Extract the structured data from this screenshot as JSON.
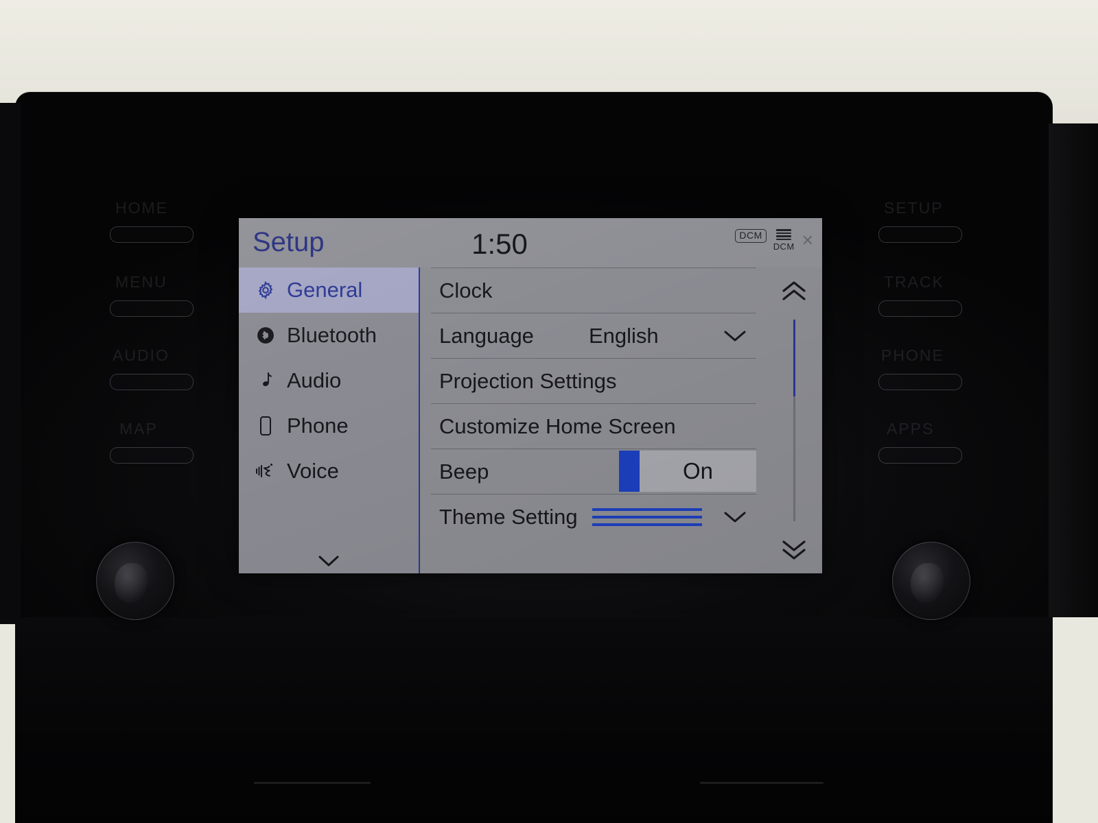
{
  "screen": {
    "header": {
      "title": "Setup",
      "clock": "1:50",
      "status": {
        "dcm_badge": "DCM",
        "signal_label": "DCM",
        "signal_icon": "signal-bars-icon",
        "badge_icon": "dcm-badge-icon"
      }
    },
    "sidebar": {
      "items": [
        {
          "label": "General",
          "icon": "gear-icon",
          "selected": true
        },
        {
          "label": "Bluetooth",
          "icon": "bluetooth-icon",
          "selected": false
        },
        {
          "label": "Audio",
          "icon": "music-note-icon",
          "selected": false
        },
        {
          "label": "Phone",
          "icon": "phone-icon",
          "selected": false
        },
        {
          "label": "Voice",
          "icon": "voice-icon",
          "selected": false
        }
      ],
      "more_icon": "chevron-down-icon"
    },
    "list": {
      "rows": [
        {
          "label": "Clock",
          "value": "",
          "control": "none"
        },
        {
          "label": "Language",
          "value": "English",
          "control": "dropdown"
        },
        {
          "label": "Projection Settings",
          "value": "",
          "control": "none"
        },
        {
          "label": "Customize Home Screen",
          "value": "",
          "control": "none"
        },
        {
          "label": "Beep",
          "value": "On",
          "control": "toggle"
        },
        {
          "label": "Theme Setting",
          "value": "",
          "control": "theme"
        }
      ]
    },
    "scrollbar": {
      "up_icon": "double-chevron-up-icon",
      "down_icon": "double-chevron-down-icon",
      "thumb_position_percent": 0,
      "thumb_size_percent": 38
    },
    "colors": {
      "accent_blue": "#2b3793",
      "toggle_blue": "#1c3fbd",
      "screen_bg": "#8b8b92",
      "selected_bg": "#a3a5c3",
      "text_dark": "#16161b"
    }
  },
  "hardware": {
    "left_buttons": [
      {
        "label": "HOME"
      },
      {
        "label": "MENU"
      },
      {
        "label": "AUDIO"
      },
      {
        "label": "MAP"
      }
    ],
    "right_buttons": [
      {
        "label": "SETUP"
      },
      {
        "label": "TRACK"
      },
      {
        "label": "PHONE"
      },
      {
        "label": "APPS"
      }
    ],
    "knobs": [
      {
        "name": "power-volume-knob"
      },
      {
        "name": "tune-scroll-knob"
      }
    ]
  }
}
